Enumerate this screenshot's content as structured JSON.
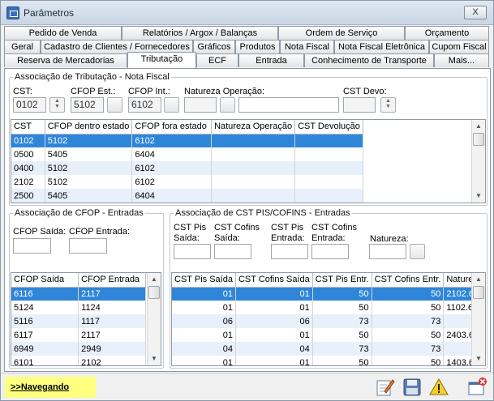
{
  "window": {
    "title": "Parâmetros",
    "close_label": "X"
  },
  "tabs": {
    "row1": [
      "Pedido de Venda",
      "Relatórios / Argox / Balanças",
      "Ordem de Serviço",
      "Orçamento"
    ],
    "row2": [
      "Geral",
      "Cadastro de Clientes / Fornecedores",
      "Gráficos",
      "Produtos",
      "Nota Fiscal",
      "Nota Fiscal Eletrônica",
      "Cupom Fiscal"
    ],
    "row3": [
      "Reserva de Mercadorias",
      "Tributação",
      "ECF",
      "Entrada",
      "Conhecimento de Transporte",
      "Mais..."
    ]
  },
  "tributacao": {
    "legend": "Associação de Tributação - Nota Fiscal",
    "cst_label": "CST:",
    "cst_value": "0102",
    "cfop_est_label": "CFOP Est.:",
    "cfop_est_value": "5102",
    "cfop_int_label": "CFOP Int.:",
    "cfop_int_value": "6102",
    "natureza_label": "Natureza Operação:",
    "natureza_code": "",
    "natureza_desc": "",
    "cst_devo_label": "CST Devo:",
    "cst_devo_value": "",
    "columns": [
      "CST",
      "CFOP dentro estado",
      "CFOP fora estado",
      "Natureza Operação",
      "CST Devolução"
    ],
    "rows": [
      [
        "0102",
        "5102",
        "6102",
        "",
        ""
      ],
      [
        "0500",
        "5405",
        "6404",
        "",
        ""
      ],
      [
        "0400",
        "5102",
        "6102",
        "",
        ""
      ],
      [
        "2102",
        "5102",
        "6102",
        "",
        ""
      ],
      [
        "2500",
        "5405",
        "6404",
        "",
        ""
      ]
    ]
  },
  "cfop_entradas": {
    "legend": "Associação de CFOP - Entradas",
    "cfop_saida_label": "CFOP Saída:",
    "cfop_entrada_label": "CFOP Entrada:",
    "columns": [
      "CFOP Saída",
      "CFOP Entrada"
    ],
    "rows": [
      [
        "6116",
        "2117"
      ],
      [
        "5124",
        "1124"
      ],
      [
        "5116",
        "1117"
      ],
      [
        "6117",
        "2117"
      ],
      [
        "6949",
        "2949"
      ],
      [
        "6101",
        "2102"
      ]
    ]
  },
  "pis_cofins": {
    "legend": "Associação de CST PIS/COFINS - Entradas",
    "pis_saida_label": [
      "CST Pis",
      "Saída:"
    ],
    "cofins_saida_label": [
      "CST Cofins",
      "Saída:"
    ],
    "pis_entrada_label": [
      "CST Pis",
      "Entrada:"
    ],
    "cofins_entrada_label": [
      "CST Cofins",
      "Entrada:"
    ],
    "natureza_label": "Natureza:",
    "columns": [
      "CST Pis Saída",
      "CST Cofins Saída",
      "CST Pis Entr.",
      "CST Cofins Entr.",
      "Natureza"
    ],
    "rows": [
      [
        "01",
        "01",
        "50",
        "50",
        "2102.6"
      ],
      [
        "01",
        "01",
        "50",
        "50",
        "1102.6"
      ],
      [
        "06",
        "06",
        "73",
        "73",
        ""
      ],
      [
        "01",
        "01",
        "50",
        "50",
        "2403.6"
      ],
      [
        "04",
        "04",
        "73",
        "73",
        ""
      ],
      [
        "01",
        "01",
        "50",
        "50",
        "1403.6"
      ]
    ]
  },
  "status": {
    "nav_label": ">>Navegando"
  },
  "icons": [
    "edit-icon",
    "save-icon",
    "warning-icon",
    "exit-icon"
  ]
}
